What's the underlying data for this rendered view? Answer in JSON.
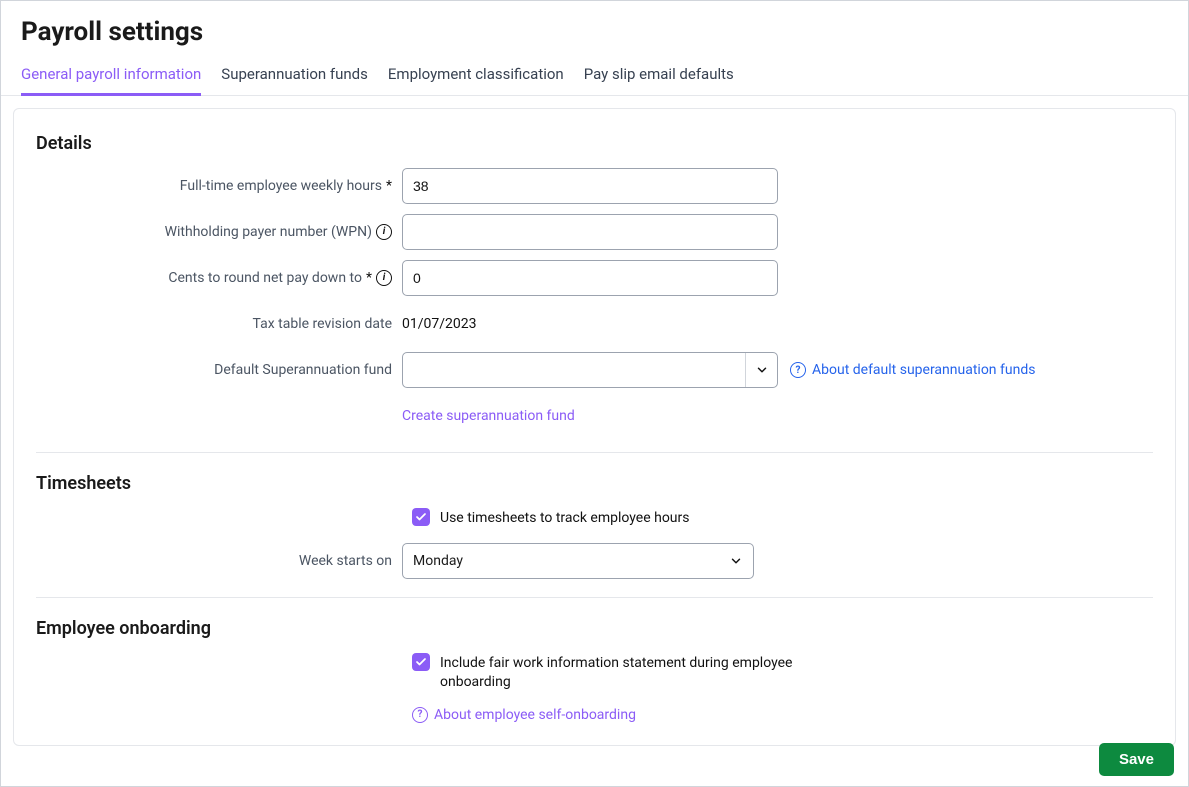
{
  "header": {
    "title": "Payroll settings"
  },
  "tabs": [
    {
      "label": "General payroll information",
      "active": true
    },
    {
      "label": "Superannuation funds",
      "active": false
    },
    {
      "label": "Employment classification",
      "active": false
    },
    {
      "label": "Pay slip email defaults",
      "active": false
    }
  ],
  "details": {
    "heading": "Details",
    "weekly_hours_label": "Full-time employee weekly hours",
    "weekly_hours_value": "38",
    "wpn_label": "Withholding payer number (WPN)",
    "wpn_value": "",
    "cents_round_label": "Cents to round net pay down to",
    "cents_round_value": "0",
    "tax_table_label": "Tax table revision date",
    "tax_table_value": "01/07/2023",
    "default_super_label": "Default Superannuation fund",
    "default_super_value": "",
    "about_super_link": "About default superannuation funds",
    "create_super_link": "Create superannuation fund"
  },
  "timesheets": {
    "heading": "Timesheets",
    "use_timesheets_label": "Use timesheets to track employee hours",
    "use_timesheets_checked": true,
    "week_starts_label": "Week starts on",
    "week_starts_value": "Monday"
  },
  "onboarding": {
    "heading": "Employee onboarding",
    "include_fairwork_label": "Include fair work information statement during employee onboarding",
    "include_fairwork_checked": true,
    "about_link": "About employee self-onboarding"
  },
  "footer": {
    "save_label": "Save"
  }
}
